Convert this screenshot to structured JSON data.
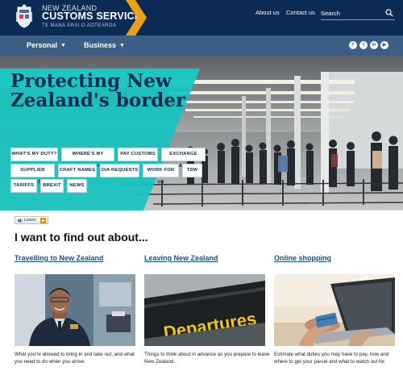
{
  "header": {
    "brand_small": "NEW ZEALAND",
    "brand_big": "CUSTOMS SERVICE",
    "brand_maori": "TE MANA ĀRAI O AOTEAROA",
    "about_link": "About us",
    "contact_link": "Contact us",
    "search_placeholder": "Search"
  },
  "nav": {
    "personal": "Personal",
    "business": "Business",
    "social_icons": [
      "facebook-icon",
      "twitter-icon",
      "linkedin-icon",
      "youtube-icon"
    ]
  },
  "hero": {
    "title": "Protecting New Zealand's border",
    "quick_links": [
      "WHAT'S MY DUTY?",
      "WHERE'S MY PARCEL?",
      "PAY CUSTOMS",
      "EXCHANGE RATES",
      "SUPPLIER CODES",
      "CRAFT NAMES",
      "OIA REQUESTS",
      "WORK FOR US",
      "TSW",
      "TARIFFS",
      "BREXIT",
      "NEWS"
    ]
  },
  "listen": {
    "label": "Listen"
  },
  "main": {
    "heading": "I want to find out about...",
    "cards": [
      {
        "link": "Travelling to New Zealand",
        "description": "What you're allowed to bring in and take out, and what you need to do when you arrive."
      },
      {
        "link": "Leaving New Zealand",
        "description": "Things to think about in advance as you prepare to leave New Zealand.",
        "sign_text": "Departures"
      },
      {
        "link": "Online shopping",
        "description": "Estimate what duties you may have to pay, how and where to get your parcel and what to watch out for."
      }
    ]
  },
  "colors": {
    "header_bg": "#0b2a54",
    "nav_bg": "#3c5f86",
    "accent_chevron": "#e8a21a",
    "hero_teal": "#16c4c0",
    "link_blue": "#1d4f86"
  }
}
